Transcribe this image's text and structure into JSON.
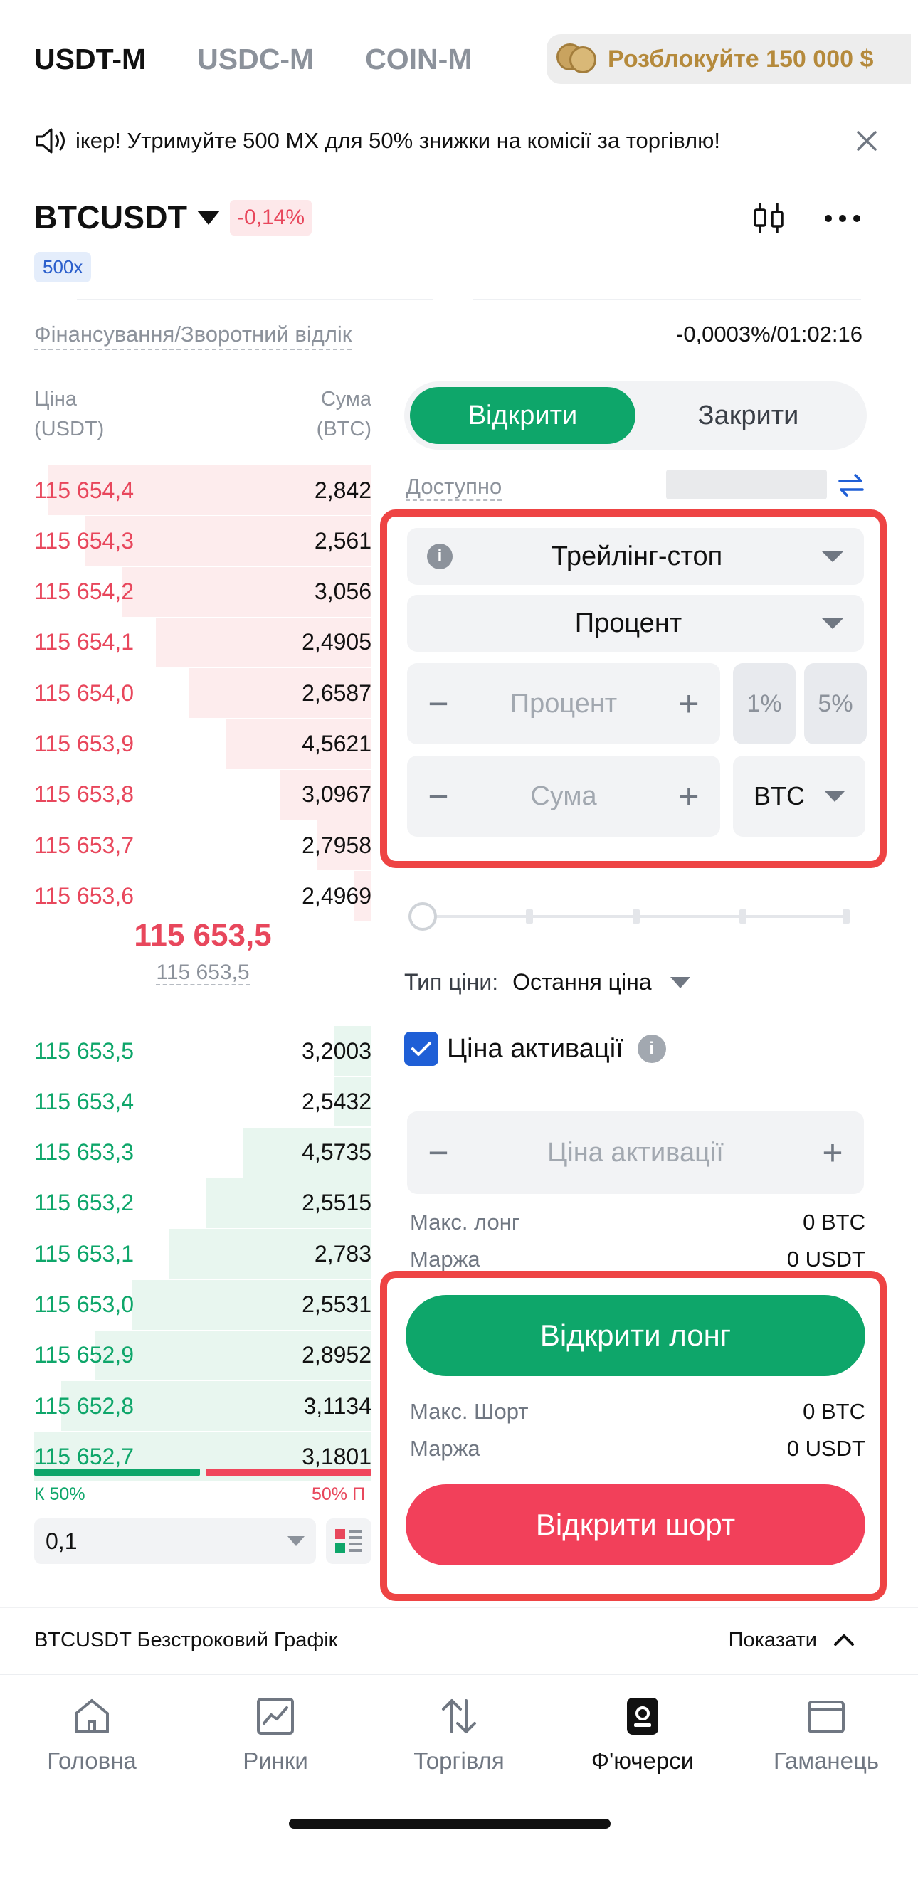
{
  "top_tabs": [
    {
      "label": "USDT-M"
    },
    {
      "label": "USDC-M"
    },
    {
      "label": "COIN-M"
    }
  ],
  "promo": {
    "text": "Розблокуйте 150 000 $"
  },
  "banner": {
    "text": "ікер! Утримуйте 500 MX для 50% знижки на комісії за торгівлю!"
  },
  "pair": {
    "name": "BTCUSDT",
    "change": "-0,14%",
    "leverage": "500x"
  },
  "funding": {
    "label": "Фінансування/Зворотний відлік",
    "value": "-0,0003%/01:02:16"
  },
  "orderbook": {
    "price_header": {
      "line1": "Ціна",
      "line2": "(USDT)"
    },
    "amount_header": {
      "line1": "Сума",
      "line2": "(BTC)"
    },
    "asks": [
      {
        "price": "115 654,4",
        "amount": "2,842",
        "depth": 0.96
      },
      {
        "price": "115 654,3",
        "amount": "2,561",
        "depth": 0.85
      },
      {
        "price": "115 654,2",
        "amount": "3,056",
        "depth": 0.74
      },
      {
        "price": "115 654,1",
        "amount": "2,4905",
        "depth": 0.64
      },
      {
        "price": "115 654,0",
        "amount": "2,6587",
        "depth": 0.54
      },
      {
        "price": "115 653,9",
        "amount": "4,5621",
        "depth": 0.43
      },
      {
        "price": "115 653,8",
        "amount": "3,0967",
        "depth": 0.27
      },
      {
        "price": "115 653,7",
        "amount": "2,7958",
        "depth": 0.16
      },
      {
        "price": "115 653,6",
        "amount": "2,4969",
        "depth": 0.05
      }
    ],
    "last_price": "115 653,5",
    "mark_price": "115 653,5",
    "bids": [
      {
        "price": "115 653,5",
        "amount": "3,2003",
        "depth": 0.11
      },
      {
        "price": "115 653,4",
        "amount": "2,5432",
        "depth": 0.11
      },
      {
        "price": "115 653,3",
        "amount": "4,5735",
        "depth": 0.38
      },
      {
        "price": "115 653,2",
        "amount": "2,5515",
        "depth": 0.49
      },
      {
        "price": "115 653,1",
        "amount": "2,783",
        "depth": 0.6
      },
      {
        "price": "115 653,0",
        "amount": "2,5531",
        "depth": 0.71
      },
      {
        "price": "115 652,9",
        "amount": "2,8952",
        "depth": 0.82
      },
      {
        "price": "115 652,8",
        "amount": "3,1134",
        "depth": 0.92
      },
      {
        "price": "115 652,7",
        "amount": "3,1801",
        "depth": 1.0
      }
    ],
    "buy_ratio": "К 50%",
    "sell_ratio": "50% П",
    "depth_step": "0,1"
  },
  "order_form": {
    "open_tab": "Відкрити",
    "close_tab": "Закрити",
    "available_label": "Доступно",
    "order_type": "Трейлінг-стоп",
    "trail_mode": "Процент",
    "percent_placeholder": "Процент",
    "preset_1": "1%",
    "preset_2": "5%",
    "amount_placeholder": "Сума",
    "unit": "BTC",
    "price_type_label": "Тип ціни:",
    "price_type_value": "Остання ціна",
    "activation_label": "Ціна активації",
    "activation_placeholder": "Ціна активації",
    "max_long_label": "Макс. лонг",
    "max_long_value": "0 BTC",
    "margin_label": "Маржа",
    "margin_value": "0 USDT",
    "open_long": "Відкрити лонг",
    "max_short_label": "Макс. Шорт",
    "max_short_value": "0 BTC",
    "margin_short_label": "Маржа",
    "margin_short_value": "0 USDT",
    "open_short": "Відкрити шорт"
  },
  "bottom_strip": {
    "title": "BTCUSDT Безстроковий Графік",
    "show": "Показати"
  },
  "nav": [
    {
      "label": "Головна",
      "icon": "home-icon"
    },
    {
      "label": "Ринки",
      "icon": "markets-icon"
    },
    {
      "label": "Торгівля",
      "icon": "trade-arrows-icon"
    },
    {
      "label": "Ф'ючерси",
      "icon": "futures-icon"
    },
    {
      "label": "Гаманець",
      "icon": "wallet-icon"
    }
  ],
  "colors": {
    "green": "#0ea66a",
    "red": "#f2405a",
    "blue": "#1f5fd6",
    "highlight": "#ee4444"
  }
}
